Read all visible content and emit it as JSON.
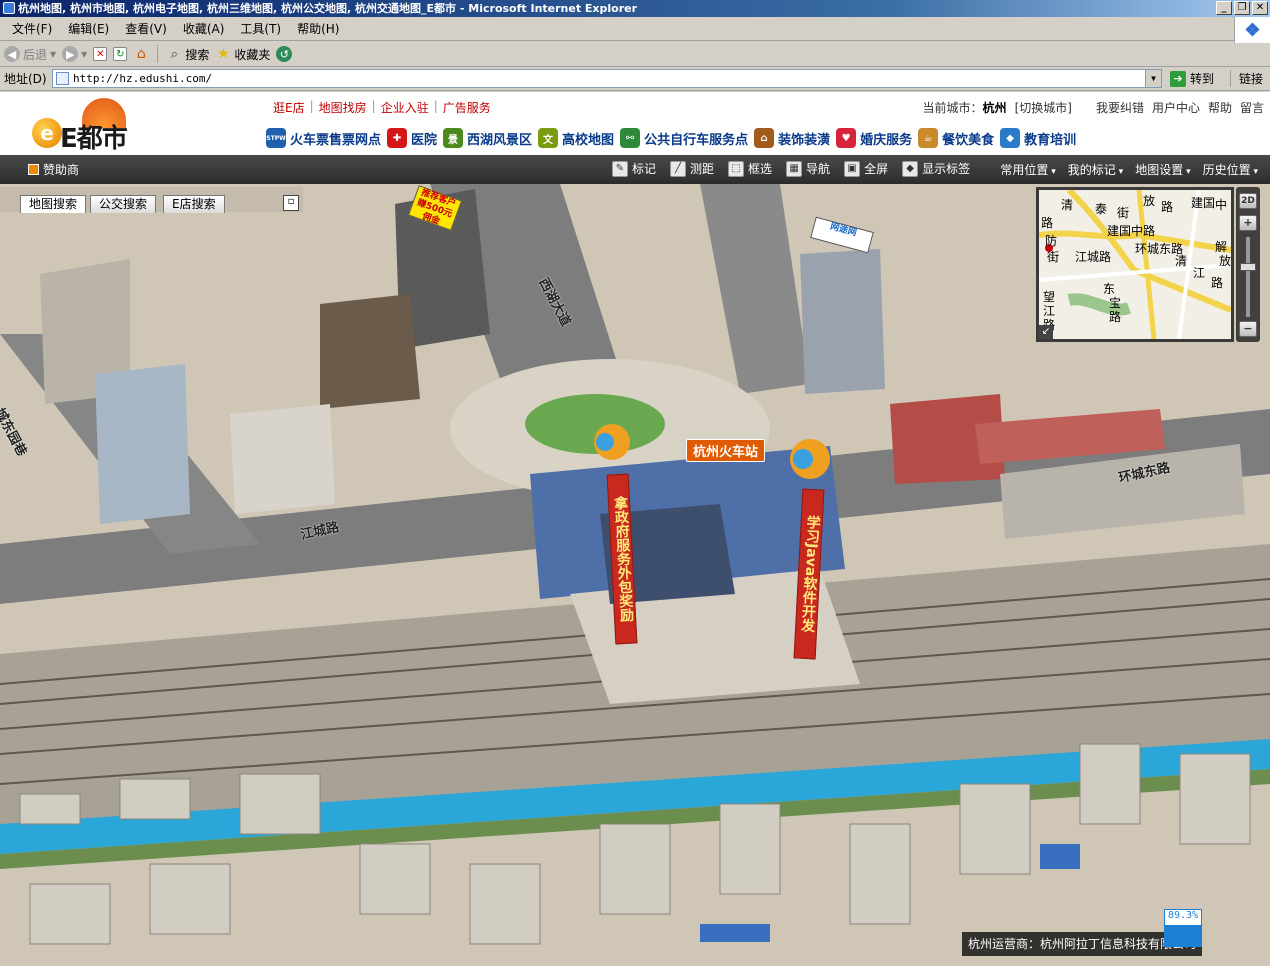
{
  "window": {
    "title": "杭州地图, 杭州市地图, 杭州电子地图, 杭州三维地图, 杭州公交地图, 杭州交通地图_E都市 - Microsoft Internet Explorer",
    "controls": [
      "_",
      "❐",
      "✕"
    ]
  },
  "menu": [
    "文件(F)",
    "编辑(E)",
    "查看(V)",
    "收藏(A)",
    "工具(T)",
    "帮助(H)"
  ],
  "toolbar": {
    "back": "后退",
    "search": "搜索",
    "favorites": "收藏夹"
  },
  "address": {
    "label": "地址(D)",
    "url": "http://hz.edushi.com/",
    "go": "转到",
    "links": "链接"
  },
  "site": {
    "brand": "E都市",
    "top_links": [
      "逛E店",
      "地图找房",
      "企业入驻",
      "广告服务"
    ],
    "city_prefix": "当前城市：",
    "city": "杭州",
    "switch_city": "[切换城市]",
    "user_links": [
      "我要纠错",
      "用户中心",
      "帮助",
      "留言"
    ],
    "categories": [
      {
        "label": "火车票售票网点",
        "icon": "train-ticket-icon",
        "color": "#1f5fae",
        "glyph": "STPW"
      },
      {
        "label": "医院",
        "icon": "hospital-cross-icon",
        "color": "#d41616",
        "glyph": "✚"
      },
      {
        "label": "西湖风景区",
        "icon": "scenic-icon",
        "color": "#4c8a1e",
        "glyph": "景"
      },
      {
        "label": "高校地图",
        "icon": "university-icon",
        "color": "#7a9a10",
        "glyph": "文"
      },
      {
        "label": "公共自行车服务点",
        "icon": "bicycle-icon",
        "color": "#2e8a3a",
        "glyph": "⚯"
      },
      {
        "label": "装饰装潢",
        "icon": "house-icon",
        "color": "#a05a1a",
        "glyph": "⌂"
      },
      {
        "label": "婚庆服务",
        "icon": "heart-icon",
        "color": "#d8243a",
        "glyph": "♥"
      },
      {
        "label": "餐饮美食",
        "icon": "food-icon",
        "color": "#c88a2a",
        "glyph": "☕"
      },
      {
        "label": "教育培训",
        "icon": "education-icon",
        "color": "#2a7ac8",
        "glyph": "◆"
      }
    ]
  },
  "map_toolbar": {
    "sponsor": "赞助商",
    "tools": [
      {
        "label": "标记",
        "icon": "mark-icon",
        "glyph": "✎"
      },
      {
        "label": "测距",
        "icon": "measure-icon",
        "glyph": "╱"
      },
      {
        "label": "框选",
        "icon": "box-select-icon",
        "glyph": "⬚"
      },
      {
        "label": "导航",
        "icon": "navigation-icon",
        "glyph": "▦"
      },
      {
        "label": "全屏",
        "icon": "fullscreen-icon",
        "glyph": "▣"
      },
      {
        "label": "显示标签",
        "icon": "tag-icon",
        "glyph": "◆"
      }
    ],
    "right": [
      "常用位置",
      "我的标记",
      "地图设置",
      "历史位置"
    ]
  },
  "search_tabs": [
    "地图搜索",
    "公交搜索",
    "E店搜索"
  ],
  "minimap": {
    "mode": "2D",
    "labels": [
      "清",
      "泰",
      "街",
      "放",
      "路",
      "建国",
      "中",
      "路",
      "建国中路",
      "防",
      "街",
      "江城路",
      "环城东路",
      "清",
      "江",
      "路",
      "解",
      "放",
      "东",
      "宝",
      "路",
      "望",
      "江",
      "路"
    ]
  },
  "map": {
    "station": "杭州火车站",
    "banner_left": "拿政府服务外包奖励",
    "banner_right": "学习Java软件开发",
    "roads": [
      "西湖大道",
      "江城路",
      "环城东路",
      "城东园巷"
    ],
    "billboard_left": "推荐客户 赚500元佣金",
    "billboard_right": "网途网",
    "operator": "杭州运营商：杭州阿拉丁信息科技有限公司",
    "zoom_percent": "89.3%",
    "zoom_fraction": 0.893
  },
  "colors": {
    "brand_red": "#c00000",
    "category_blue": "#0a3a8a",
    "map_toolbar": "#333333",
    "river": "#2aa7d8"
  }
}
